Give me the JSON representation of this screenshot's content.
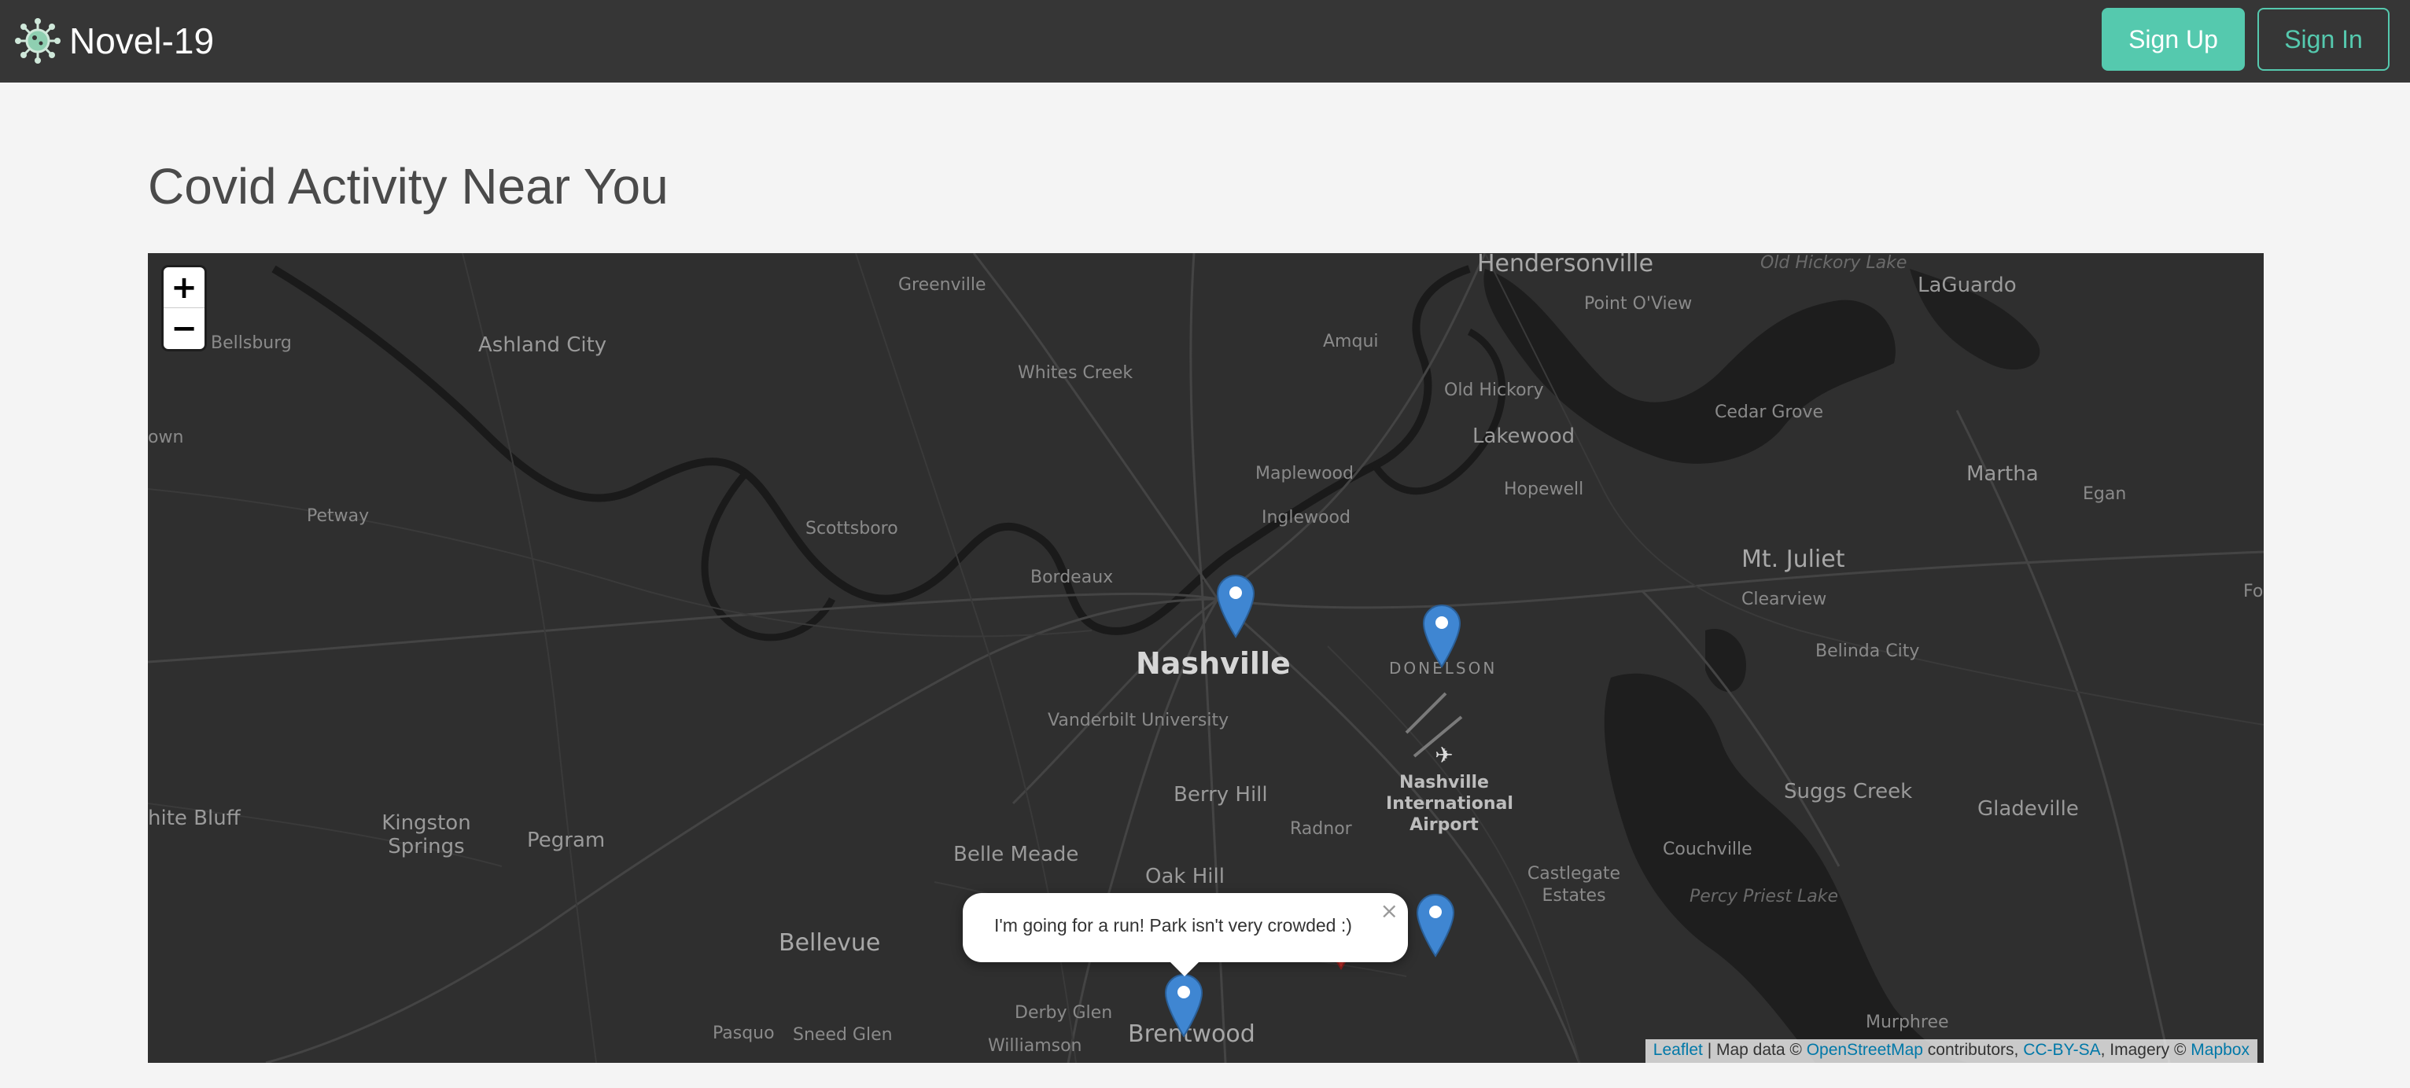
{
  "navbar": {
    "brand_name": "Novel-19",
    "sign_up": "Sign Up",
    "sign_in": "Sign In",
    "accent_color": "#55c9ae",
    "logo_icon": "virus-icon"
  },
  "page": {
    "title": "Covid Activity Near You"
  },
  "map": {
    "zoom_in": "+",
    "zoom_out": "−",
    "labels": {
      "hendersonville": "Hendersonville",
      "old_hickory_lake": "Old Hickory Lake",
      "laguardo": "LaGuardo",
      "greenville": "Greenville",
      "point_oview": "Point O'View",
      "bellsburg": "Bellsburg",
      "ashland_city": "Ashland City",
      "amqui": "Amqui",
      "whites_creek": "Whites Creek",
      "old_hickory": "Old Hickory",
      "cedar_grove": "Cedar Grove",
      "town": "own",
      "lakewood": "Lakewood",
      "maplewood": "Maplewood",
      "martha": "Martha",
      "hopewell": "Hopewell",
      "egan": "Egan",
      "petway": "Petway",
      "inglewood": "Inglewood",
      "scottsboro": "Scottsboro",
      "mt_juliet": "Mt. Juliet",
      "bordeaux": "Bordeaux",
      "clearview": "Clearview",
      "fo": "Fo",
      "belinda_city": "Belinda City",
      "nashville": "Nashville",
      "donelson": "DONELSON",
      "vanderbilt": "Vanderbilt University",
      "airport": "Nashville International Airport",
      "suggs_creek": "Suggs Creek",
      "berry_hill": "Berry Hill",
      "gladeville": "Gladeville",
      "white_bluff": "hite Bluff",
      "kingston_springs": "Kingston Springs",
      "radnor": "Radnor",
      "pegram": "Pegram",
      "couchville": "Couchville",
      "belle_meade": "Belle Meade",
      "castlegate_estates": "Castlegate Estates",
      "oak_hill": "Oak Hill",
      "percy_priest_lake": "Percy Priest Lake",
      "bellevue": "Bellevue",
      "murphree": "Murphree",
      "derby_glen": "Derby Glen",
      "pasquo": "Pasquo",
      "sneed_glen": "Sneed Glen",
      "brentwood": "Brentwood",
      "williamson": "Williamson"
    },
    "popup_text": "I'm going for a run! Park isn't very crowded :)",
    "popup_close": "×",
    "marker_colors": {
      "blue": "#3f86d2",
      "red": "#c8322d"
    },
    "attribution": {
      "leaflet": "Leaflet",
      "sep1": " | Map data © ",
      "osm": "OpenStreetMap",
      "contributors": " contributors, ",
      "ccbysa": "CC-BY-SA",
      "imagery": ", Imagery © ",
      "mapbox": "Mapbox"
    }
  }
}
